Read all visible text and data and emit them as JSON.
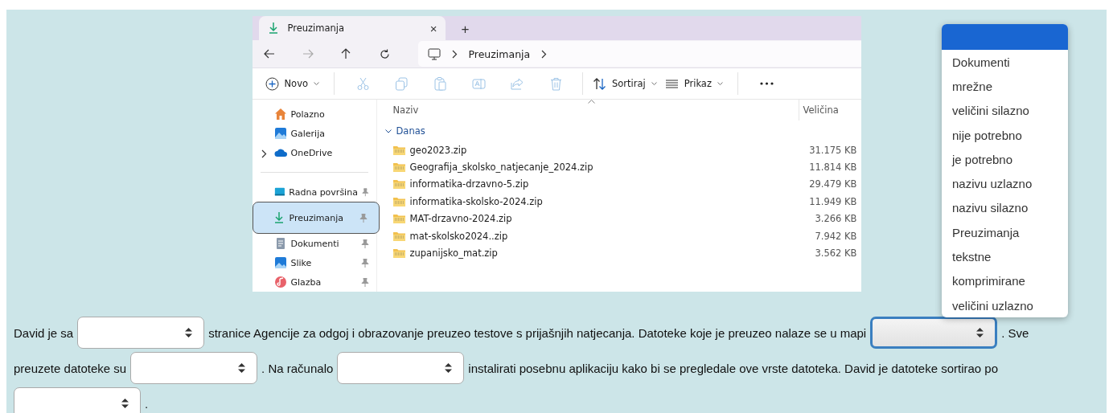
{
  "explorer": {
    "tab": {
      "title": "Preuzimanja",
      "selected": true,
      "close": "×"
    },
    "new_tab": "+",
    "address": {
      "path": [
        "Preuzimanja"
      ]
    },
    "toolbar": [
      {
        "kind": "new",
        "label": "Novo"
      },
      {
        "kind": "cut",
        "disabled": true
      },
      {
        "kind": "copy",
        "disabled": true
      },
      {
        "kind": "paste",
        "disabled": true
      },
      {
        "kind": "rename",
        "disabled": true
      },
      {
        "kind": "share",
        "disabled": true
      },
      {
        "kind": "delete",
        "disabled": true
      },
      {
        "kind": "sort",
        "label": "Sortiraj"
      },
      {
        "kind": "view",
        "label": "Prikaz"
      },
      {
        "kind": "more"
      }
    ],
    "sidebar": [
      {
        "kind": "home",
        "label": "Polazno",
        "selected": false,
        "pinned": false,
        "expandable": false
      },
      {
        "kind": "gallery",
        "label": "Galerija",
        "selected": false,
        "pinned": false,
        "expandable": false
      },
      {
        "kind": "cloud",
        "label": "OneDrive",
        "selected": false,
        "pinned": false,
        "expandable": true
      },
      {
        "kind": "divider"
      },
      {
        "kind": "desktop",
        "label": "Radna površina",
        "selected": false,
        "pinned": true,
        "expandable": false
      },
      {
        "kind": "download",
        "label": "Preuzimanja",
        "selected": true,
        "pinned": true,
        "expandable": false
      },
      {
        "kind": "document",
        "label": "Dokumenti",
        "selected": false,
        "pinned": true,
        "expandable": false
      },
      {
        "kind": "image",
        "label": "Slike",
        "selected": false,
        "pinned": true,
        "expandable": false
      },
      {
        "kind": "music",
        "label": "Glazba",
        "selected": false,
        "pinned": true,
        "expandable": false
      }
    ],
    "columns": [
      "Naziv",
      "Veličina"
    ],
    "group": "Danas",
    "files": [
      {
        "name": "geo2023.zip",
        "size": "31.175 KB"
      },
      {
        "name": "Geografija_skolsko_natjecanje_2024.zip",
        "size": "11.814 KB"
      },
      {
        "name": "informatika-drzavno-5.zip",
        "size": "29.479 KB"
      },
      {
        "name": "informatika-skolsko-2024.zip",
        "size": "11.949 KB"
      },
      {
        "name": "MAT-drzavno-2024.zip",
        "size": "3.266 KB"
      },
      {
        "name": "mat-skolsko2024..zip",
        "size": "7.942 KB"
      },
      {
        "name": "zupanijsko_mat.zip",
        "size": "3.562 KB"
      }
    ]
  },
  "question": [
    [
      {
        "kind": "text",
        "text": "David je sa"
      },
      {
        "kind": "select",
        "open": false
      },
      {
        "kind": "text",
        "text": "stranice Agencije za odgoj i obrazovanje preuzeo testove s prijašnjih natjecanja. Datoteke koje je preuzeo nalaze se u mapi"
      },
      {
        "kind": "select",
        "open": true
      },
      {
        "kind": "text",
        "text": ". Sve"
      }
    ],
    [
      {
        "kind": "text",
        "text": "preuzete datoteke su"
      },
      {
        "kind": "select",
        "open": false
      },
      {
        "kind": "text",
        "text": ". Na računalo"
      },
      {
        "kind": "select",
        "open": false
      },
      {
        "kind": "text",
        "text": "instalirati posebnu aplikaciju kako bi se pregledale ove vrste datoteka. David je datoteke sortirao po"
      }
    ],
    [
      {
        "kind": "select",
        "open": false
      },
      {
        "kind": "text",
        "text": "."
      }
    ]
  ],
  "dropdown_options": [
    "Dokumenti",
    "mrežne",
    "veličini silazno",
    "nije potrebno",
    "je potrebno",
    "nazivu uzlazno",
    "nazivu silazno",
    "Preuzimanja",
    "tekstne",
    "komprimirane",
    "veličini uzlazno"
  ]
}
